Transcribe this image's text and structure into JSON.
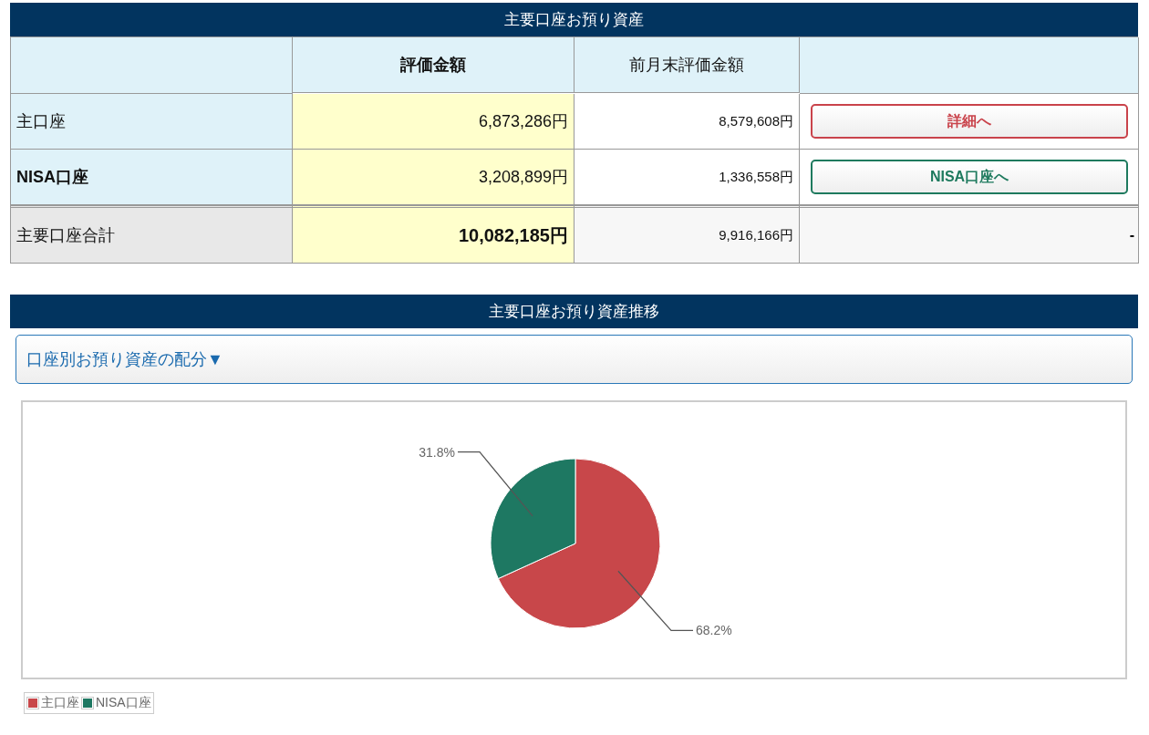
{
  "assets": {
    "title": "主要口座お預り資産",
    "columns": [
      {
        "kind": "blank"
      },
      {
        "kind": "label",
        "label": "評価金額",
        "bold": true
      },
      {
        "kind": "label",
        "label": "前月末評価金額",
        "bold": false
      },
      {
        "kind": "blank"
      }
    ],
    "rows": [
      {
        "kind": "account",
        "name": "主口座",
        "bold_name": false,
        "value": "6,873,286円",
        "bold_value": false,
        "previous": "8,579,608円",
        "action": {
          "kind": "button",
          "label": "詳細へ",
          "color": "#c9434b"
        }
      },
      {
        "kind": "account",
        "name": "NISA口座",
        "bold_name": true,
        "value": "3,208,899円",
        "bold_value": false,
        "previous": "1,336,558円",
        "action": {
          "kind": "button",
          "label": "NISA口座へ",
          "color": "#1e7a5e"
        }
      },
      {
        "kind": "total",
        "name": "主要口座合計",
        "bold_name": false,
        "value": "10,082,185円",
        "bold_value": true,
        "previous": "9,916,166円",
        "action": {
          "kind": "text",
          "label": "-"
        }
      }
    ]
  },
  "history": {
    "title": "主要口座お預り資産推移",
    "toggle": {
      "label": "口座別お預り資産の配分▼"
    },
    "chart_data": {
      "type": "pie",
      "categories": [
        "主口座",
        "NISA口座"
      ],
      "values": [
        68.2,
        31.8
      ],
      "value_labels": [
        "68.2%",
        "31.8%"
      ]
    },
    "legend": [
      {
        "color": "#c8474a"
      },
      {
        "color": "#1e7862"
      }
    ]
  }
}
